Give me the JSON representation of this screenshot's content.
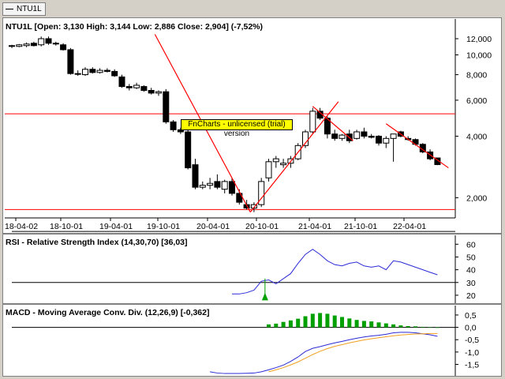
{
  "tab": {
    "label": "NTU1L"
  },
  "watermark": "FnCharts - unlicensed (trial) version",
  "colors": {
    "up": "#ffffff",
    "down": "#000000",
    "trend": "#ff0000",
    "rsi": "#2b2bd6",
    "macd": "#2b2bd6",
    "signal": "#f0a020",
    "hist": "#00a000"
  },
  "chart_data": [
    {
      "type": "candlestick",
      "title": "NTU1L [Open: 3,130  High: 3,144  Low: 2,886  Close: 2,904] (-7,52%)",
      "x_ticks": [
        "18-04-02",
        "18-10-01",
        "19-04-01",
        "19-10-01",
        "20-04-01",
        "20-10-01",
        "21-04-01",
        "21-10-01",
        "22-04-01"
      ],
      "y_ticks": [
        "2,000",
        "4,000",
        "6,000",
        "8,000",
        "10,000",
        "12,000"
      ],
      "y_scale": "log",
      "ylim": [
        1.65,
        13.0
      ],
      "candles": [
        {
          "o": 11.0,
          "h": 11.2,
          "l": 10.8,
          "c": 11.1
        },
        {
          "o": 11.0,
          "h": 11.3,
          "l": 10.9,
          "c": 11.2
        },
        {
          "o": 11.1,
          "h": 11.5,
          "l": 10.9,
          "c": 11.3
        },
        {
          "o": 11.4,
          "h": 11.6,
          "l": 11.0,
          "c": 11.1
        },
        {
          "o": 11.2,
          "h": 12.3,
          "l": 11.0,
          "c": 12.0
        },
        {
          "o": 12.0,
          "h": 12.3,
          "l": 11.2,
          "c": 11.4
        },
        {
          "o": 11.4,
          "h": 11.6,
          "l": 11.1,
          "c": 11.3
        },
        {
          "o": 11.2,
          "h": 11.4,
          "l": 10.5,
          "c": 10.6
        },
        {
          "o": 10.6,
          "h": 10.8,
          "l": 8.0,
          "c": 8.1
        },
        {
          "o": 8.1,
          "h": 8.4,
          "l": 7.9,
          "c": 8.1
        },
        {
          "o": 8.0,
          "h": 8.7,
          "l": 7.9,
          "c": 8.5
        },
        {
          "o": 8.5,
          "h": 8.7,
          "l": 8.1,
          "c": 8.2
        },
        {
          "o": 8.2,
          "h": 8.6,
          "l": 8.1,
          "c": 8.4
        },
        {
          "o": 8.4,
          "h": 8.6,
          "l": 8.2,
          "c": 8.3
        },
        {
          "o": 8.3,
          "h": 8.5,
          "l": 7.8,
          "c": 7.9
        },
        {
          "o": 7.8,
          "h": 8.0,
          "l": 6.9,
          "c": 7.0
        },
        {
          "o": 7.0,
          "h": 7.2,
          "l": 6.7,
          "c": 6.9
        },
        {
          "o": 6.9,
          "h": 7.3,
          "l": 6.8,
          "c": 7.1
        },
        {
          "o": 7.0,
          "h": 7.1,
          "l": 6.6,
          "c": 6.7
        },
        {
          "o": 6.7,
          "h": 6.9,
          "l": 6.4,
          "c": 6.5
        },
        {
          "o": 6.5,
          "h": 6.7,
          "l": 6.3,
          "c": 6.6
        },
        {
          "o": 6.6,
          "h": 6.8,
          "l": 4.6,
          "c": 4.7
        },
        {
          "o": 4.7,
          "h": 4.8,
          "l": 4.2,
          "c": 4.3
        },
        {
          "o": 4.3,
          "h": 4.4,
          "l": 4.1,
          "c": 4.2
        },
        {
          "o": 4.2,
          "h": 4.3,
          "l": 2.75,
          "c": 2.8
        },
        {
          "o": 2.9,
          "h": 3.1,
          "l": 2.2,
          "c": 2.25
        },
        {
          "o": 2.25,
          "h": 2.4,
          "l": 2.2,
          "c": 2.3
        },
        {
          "o": 2.3,
          "h": 2.5,
          "l": 2.2,
          "c": 2.35
        },
        {
          "o": 2.4,
          "h": 2.6,
          "l": 2.2,
          "c": 2.25
        },
        {
          "o": 2.2,
          "h": 2.45,
          "l": 2.1,
          "c": 2.4
        },
        {
          "o": 2.4,
          "h": 2.5,
          "l": 2.05,
          "c": 2.1
        },
        {
          "o": 2.1,
          "h": 2.2,
          "l": 1.85,
          "c": 1.9
        },
        {
          "o": 1.85,
          "h": 1.95,
          "l": 1.75,
          "c": 1.78
        },
        {
          "o": 1.78,
          "h": 1.9,
          "l": 1.7,
          "c": 1.85
        },
        {
          "o": 1.85,
          "h": 2.5,
          "l": 1.8,
          "c": 2.4
        },
        {
          "o": 2.5,
          "h": 3.1,
          "l": 2.4,
          "c": 3.0
        },
        {
          "o": 3.0,
          "h": 3.2,
          "l": 2.8,
          "c": 3.1
        },
        {
          "o": 2.9,
          "h": 3.1,
          "l": 2.8,
          "c": 2.95
        },
        {
          "o": 2.95,
          "h": 3.2,
          "l": 2.8,
          "c": 3.1
        },
        {
          "o": 3.1,
          "h": 3.7,
          "l": 3.05,
          "c": 3.6
        },
        {
          "o": 3.6,
          "h": 4.3,
          "l": 3.5,
          "c": 4.2
        },
        {
          "o": 4.2,
          "h": 5.5,
          "l": 4.1,
          "c": 5.3
        },
        {
          "o": 5.3,
          "h": 5.5,
          "l": 4.8,
          "c": 4.9
        },
        {
          "o": 4.9,
          "h": 5.0,
          "l": 3.9,
          "c": 4.1
        },
        {
          "o": 4.1,
          "h": 4.3,
          "l": 3.8,
          "c": 3.9
        },
        {
          "o": 3.9,
          "h": 4.1,
          "l": 3.8,
          "c": 4.05
        },
        {
          "o": 4.1,
          "h": 4.3,
          "l": 3.7,
          "c": 3.8
        },
        {
          "o": 3.9,
          "h": 4.3,
          "l": 3.85,
          "c": 4.2
        },
        {
          "o": 4.2,
          "h": 4.4,
          "l": 3.9,
          "c": 4.0
        },
        {
          "o": 4.0,
          "h": 4.1,
          "l": 3.9,
          "c": 3.95
        },
        {
          "o": 4.0,
          "h": 4.05,
          "l": 3.6,
          "c": 3.7
        },
        {
          "o": 3.7,
          "h": 4.0,
          "l": 3.5,
          "c": 3.9
        },
        {
          "o": 3.9,
          "h": 4.1,
          "l": 3.0,
          "c": 4.1
        },
        {
          "o": 4.2,
          "h": 4.25,
          "l": 3.95,
          "c": 4.0
        },
        {
          "o": 3.9,
          "h": 4.0,
          "l": 3.8,
          "c": 3.85
        },
        {
          "o": 3.85,
          "h": 3.9,
          "l": 3.6,
          "c": 3.65
        },
        {
          "o": 3.65,
          "h": 3.7,
          "l": 3.3,
          "c": 3.35
        },
        {
          "o": 3.35,
          "h": 3.45,
          "l": 3.05,
          "c": 3.1
        },
        {
          "o": 3.13,
          "h": 3.144,
          "l": 2.886,
          "c": 2.904
        }
      ],
      "horizontal_lines": [
        5.15,
        1.75
      ],
      "trend_lines": [
        [
          {
            "i": 19.5,
            "v": 12.6
          },
          {
            "i": 32.5,
            "v": 1.7
          }
        ],
        [
          {
            "i": 32.5,
            "v": 1.7
          },
          {
            "i": 44.5,
            "v": 5.9
          }
        ],
        [
          {
            "i": 41.0,
            "v": 5.6
          },
          {
            "i": 46.5,
            "v": 3.8
          }
        ],
        [
          {
            "i": 51.0,
            "v": 4.6
          },
          {
            "i": 59.5,
            "v": 2.8
          }
        ]
      ]
    },
    {
      "type": "line",
      "title": "RSI - Relative Strength Index (14,30,70) [36,03]",
      "y_ticks": [
        "20",
        "30",
        "40",
        "50",
        "60"
      ],
      "ylim": [
        15,
        67
      ],
      "levels": [
        70,
        30
      ],
      "start_index": 30,
      "values": [
        21,
        21,
        22,
        24,
        31,
        32,
        29,
        33,
        37,
        45,
        52,
        56,
        52,
        47,
        44,
        43,
        45,
        46,
        43,
        42,
        43,
        40,
        47,
        46,
        44,
        42,
        40,
        38,
        36.03
      ],
      "signal_marker": {
        "i": 34.5,
        "v": 30
      }
    },
    {
      "type": "bar+line",
      "title": "MACD - Moving Average Conv. Div. (12,26,9) [-0,362]",
      "y_ticks": [
        "-1,5",
        "-1,0",
        "-0,5",
        "0,0",
        "0,5"
      ],
      "ylim": [
        -1.9,
        0.85
      ],
      "start_index": 27,
      "macd": [
        -1.8,
        -1.85,
        -1.87,
        -1.87,
        -1.87,
        -1.86,
        -1.85,
        -1.8,
        -1.72,
        -1.63,
        -1.53,
        -1.38,
        -1.2,
        -0.98,
        -0.85,
        -0.78,
        -0.7,
        -0.63,
        -0.57,
        -0.5,
        -0.44,
        -0.39,
        -0.35,
        -0.32,
        -0.28,
        -0.22,
        -0.2,
        -0.2,
        -0.22,
        -0.26,
        -0.3,
        -0.362
      ],
      "signal_start_index": 35,
      "signal": [
        -1.8,
        -1.72,
        -1.63,
        -1.52,
        -1.4,
        -1.25,
        -1.1,
        -0.97,
        -0.86,
        -0.77,
        -0.7,
        -0.63,
        -0.57,
        -0.51,
        -0.46,
        -0.42,
        -0.38,
        -0.34,
        -0.31,
        -0.29,
        -0.27,
        -0.26,
        -0.25,
        -0.25
      ],
      "hist_start_index": 35,
      "hist": [
        0.12,
        0.15,
        0.22,
        0.28,
        0.35,
        0.45,
        0.55,
        0.58,
        0.55,
        0.48,
        0.42,
        0.36,
        0.3,
        0.26,
        0.24,
        0.2,
        0.16,
        0.12,
        0.08,
        0.05,
        0.04,
        0.02,
        0.0,
        -0.02
      ]
    }
  ]
}
